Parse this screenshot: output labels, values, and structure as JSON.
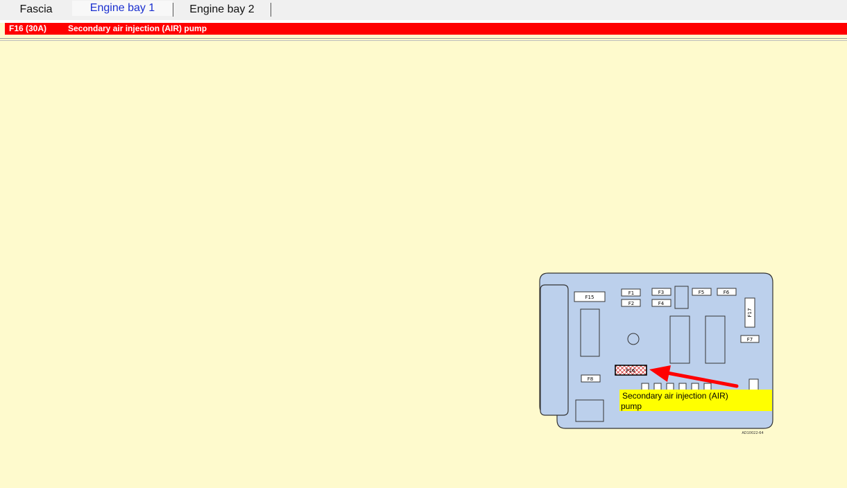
{
  "tabs": [
    {
      "label": "Fascia",
      "active": false
    },
    {
      "label": "Engine bay 1",
      "active": true
    },
    {
      "label": "Engine bay 2",
      "active": false
    }
  ],
  "selected_fuse": {
    "code": "F16 (30A)",
    "description": "Secondary air injection (AIR) pump"
  },
  "diagram": {
    "fuse_labels": {
      "f15": "F15",
      "f1": "F1",
      "f2": "F2",
      "f3": "F3",
      "f4": "F4",
      "f5": "F5",
      "f6": "F6",
      "f17": "F17",
      "f7": "F7",
      "f8": "F8",
      "f16": "F16"
    },
    "callout_line1": "Secondary air injection (AIR)",
    "callout_line2": "pump",
    "reference_code": "AD10022-64"
  },
  "colors": {
    "background": "#fefacd",
    "header_bar": "#ff0000",
    "fusebox": "#bcd0ec",
    "callout": "#ffff00",
    "arrow": "#ff0000",
    "active_tab_text": "#1a2fcf"
  }
}
